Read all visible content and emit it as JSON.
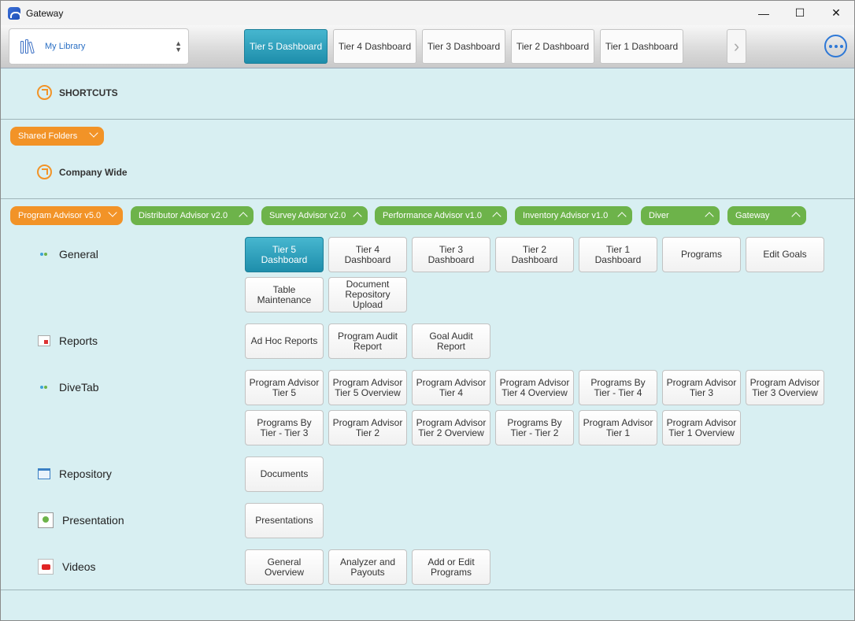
{
  "window": {
    "title": "Gateway",
    "controls": {
      "minimize": "—",
      "maximize": "☐",
      "close": "✕"
    }
  },
  "toolbar": {
    "library_label": "My Library",
    "tabs": [
      "Tier 5 Dashboard",
      "Tier 4 Dashboard",
      "Tier 3 Dashboard",
      "Tier 2 Dashboard",
      "Tier 1 Dashboard"
    ],
    "next_glyph": "›"
  },
  "shortcuts": {
    "title": "SHORTCUTS"
  },
  "shared_folders": {
    "pill": "Shared Folders",
    "company_wide": "Company Wide"
  },
  "product_tabs": [
    "Program Advisor v5.0",
    "Distributor Advisor v2.0",
    "Survey Advisor v2.0",
    "Performance Advisor v1.0",
    "Inventory Advisor v1.0",
    "Diver",
    "Gateway"
  ],
  "categories": {
    "general": {
      "label": "General",
      "buttons": [
        "Tier 5 Dashboard",
        "Tier 4 Dashboard",
        "Tier 3 Dashboard",
        "Tier 2 Dashboard",
        "Tier 1 Dashboard",
        "Programs",
        "Edit Goals",
        "Table Maintenance",
        "Document Repository Upload"
      ]
    },
    "reports": {
      "label": "Reports",
      "buttons": [
        "Ad Hoc Reports",
        "Program Audit Report",
        "Goal Audit Report"
      ]
    },
    "divetab": {
      "label": "DiveTab",
      "buttons": [
        "Program Advisor Tier 5",
        "Program Advisor Tier 5 Overview",
        "Program Advisor Tier 4",
        "Program Advisor Tier 4 Overview",
        "Programs By Tier - Tier 4",
        "Program Advisor Tier 3",
        "Program Advisor Tier 3 Overview",
        "Programs By Tier - Tier 3",
        "Program Advisor Tier 2",
        "Program Advisor Tier 2 Overview",
        "Programs By Tier - Tier 2",
        "Program Advisor Tier 1",
        "Program Advisor Tier 1 Overview"
      ]
    },
    "repository": {
      "label": "Repository",
      "buttons": [
        "Documents"
      ]
    },
    "presentation": {
      "label": "Presentation",
      "buttons": [
        "Presentations"
      ]
    },
    "videos": {
      "label": "Videos",
      "buttons": [
        "General Overview",
        "Analyzer and Payouts",
        "Add or Edit Programs"
      ]
    }
  },
  "colors": {
    "accent": "#1e8eab",
    "orange": "#f29327",
    "green": "#6db34a",
    "background": "#d8eff2"
  }
}
